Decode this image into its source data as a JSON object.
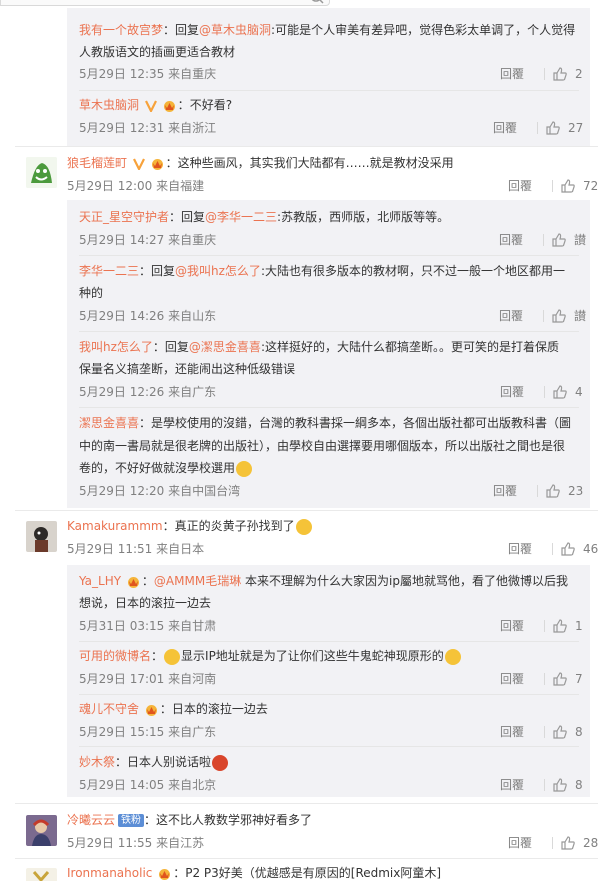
{
  "top": {
    "icons": [
      "search-icon",
      "minus-icon",
      "expand-icon"
    ]
  },
  "labels": {
    "reply": "回覆"
  },
  "threads": [
    {
      "id": "t0",
      "sub": [
        {
          "name": "我有一个故宫梦",
          "pre": "：回复",
          "at": "@草木虫脑洞",
          "text1": ":可能是个人审美有差异吧，觉得色彩太单调了，个人觉得",
          "text2": "人教版语文的插画更适合教材",
          "time": "5月29日 12:35 来自重庆",
          "likes": "2"
        },
        {
          "name": "草木虫脑洞",
          "v": true,
          "crown": true,
          "pre": "：",
          "text1": "不好看?",
          "time": "5月29日 12:31 来自浙江",
          "likes": "27"
        }
      ]
    },
    {
      "id": "t1",
      "name": "狼毛榴莲町",
      "v": true,
      "crown": true,
      "text": "：这种些画风，其实我们大陆都有……就是教材没采用",
      "time": "5月29日 12:00 来自福建",
      "likes": "72",
      "sub": [
        {
          "name": "天正_星空守护者",
          "pre": "：回复",
          "at": "@李华一二三",
          "text1": ":苏教版，西师版，北师版等等。",
          "time": "5月29日 14:27 来自重庆",
          "likes": "讃"
        },
        {
          "name": "李华一二三",
          "pre": "：回复",
          "at": "@我叫hz怎么了",
          "text1": ":大陆也有很多版本的教材啊，只不过一般一个地区都用一",
          "text2": "种的",
          "time": "5月29日 14:26 来自山东",
          "likes": "讃"
        },
        {
          "name": "我叫hz怎么了",
          "pre": "：回复",
          "at": "@潔思金喜喜",
          "text1": ":这样挺好的，大陆什么都搞垄断。。更可笑的是打着保质",
          "text2": "保量名义搞垄断，还能闹出这种低级错误",
          "time": "5月29日 12:26 来自广东",
          "likes": "4"
        },
        {
          "name": "潔思金喜喜",
          "pre": "：",
          "text1": "是學校使用的沒錯，台灣的教科書採一綱多本，各個出版社都可出版教科書（圖",
          "text2": "中的南一書局就是很老牌的出版社），由學校自由選擇要用哪個版本，所以出版社之間也是很",
          "text3": "卷的，不好好做就沒學校選用",
          "emoji3": true,
          "time": "5月29日 12:20 来自中国台湾",
          "likes": "23"
        }
      ]
    },
    {
      "id": "t2",
      "name": "Kamakurammm",
      "text": "：真正的炎黄子孙找到了",
      "emojiEnd": true,
      "time": "5月29日 11:51 来自日本",
      "likes": "46",
      "sub": [
        {
          "name": "Ya_LHY",
          "crown": true,
          "pre": "：",
          "at": "@AMMM毛瑞琳",
          "text1": " 本来不理解为什么大家因为ip屬地就骂他，看了他微博以后我",
          "text2": "想说，日本的滚拉一边去",
          "time": "5月31日 03:15 来自甘肃",
          "likes": "1"
        },
        {
          "name": "可用的微博名",
          "pre": "：",
          "emojiStart": true,
          "text1": "显示IP地址就是为了让你们这些牛鬼蛇神现原形的",
          "emojiEnd": true,
          "time": "5月29日 17:01 来自河南",
          "likes": "7"
        },
        {
          "name": "魂儿不守舍",
          "crown": true,
          "pre": "：",
          "text1": "日本的滚拉一边去",
          "time": "5月29日 15:15 来自广东",
          "likes": "8"
        },
        {
          "name": "妙木祭",
          "pre": "：",
          "text1": "日本人别说话啦",
          "emojiRed": true,
          "time": "5月29日 14:05 来自北京",
          "likes": "8"
        }
      ]
    },
    {
      "id": "t3",
      "name": "冷曦云云",
      "fan": "铁粉",
      "text": "：这不比人教数学邪神好看多了",
      "time": "5月29日 11:55 来自江苏",
      "likes": "28"
    },
    {
      "id": "t4",
      "name": "Ironmanaholic",
      "crown": true,
      "text": "：P2 P3好美（优越感是有原因的[Redmix阿童木]"
    }
  ]
}
